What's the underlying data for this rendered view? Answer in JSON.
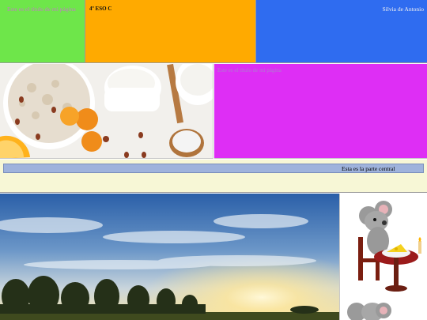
{
  "header": {
    "title": "Este es el título de mi página",
    "course": "4º ESO C",
    "author": "Silvia de Antonio"
  },
  "panel": {
    "magenta_text": "Este es el título de mi página"
  },
  "central": {
    "label": "Esta es la parte central"
  },
  "colors": {
    "green": "#6ee64a",
    "orange": "#ffaa00",
    "blue": "#2f6cf0",
    "magenta": "#de2ef5",
    "cream": "#f7f7d6",
    "bar": "#9fb3dc"
  },
  "images": {
    "food": "breakfast-oats-milk-apricots",
    "landscape": "sunset-field-trees",
    "mouse": "cartoon-mouse-eating-cheese"
  }
}
